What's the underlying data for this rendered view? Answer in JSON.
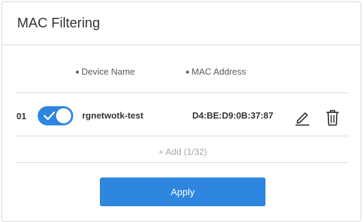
{
  "card": {
    "title": "MAC Filtering"
  },
  "columns": {
    "device_name": "Device Name",
    "mac_address": "MAC Address"
  },
  "rows": [
    {
      "index": "01",
      "enabled": true,
      "device_name": "rgnetwotk-test",
      "mac": "D4:BE:D9:0B:37:87"
    }
  ],
  "add": {
    "label": "+ Add (1/32)"
  },
  "apply": {
    "label": "Apply"
  },
  "colors": {
    "accent": "#2e86de",
    "border": "#d9d9d9",
    "muted": "#a6a6a6"
  },
  "icons": {
    "toggle": "check-icon",
    "edit": "pencil-icon",
    "delete": "trash-icon"
  }
}
